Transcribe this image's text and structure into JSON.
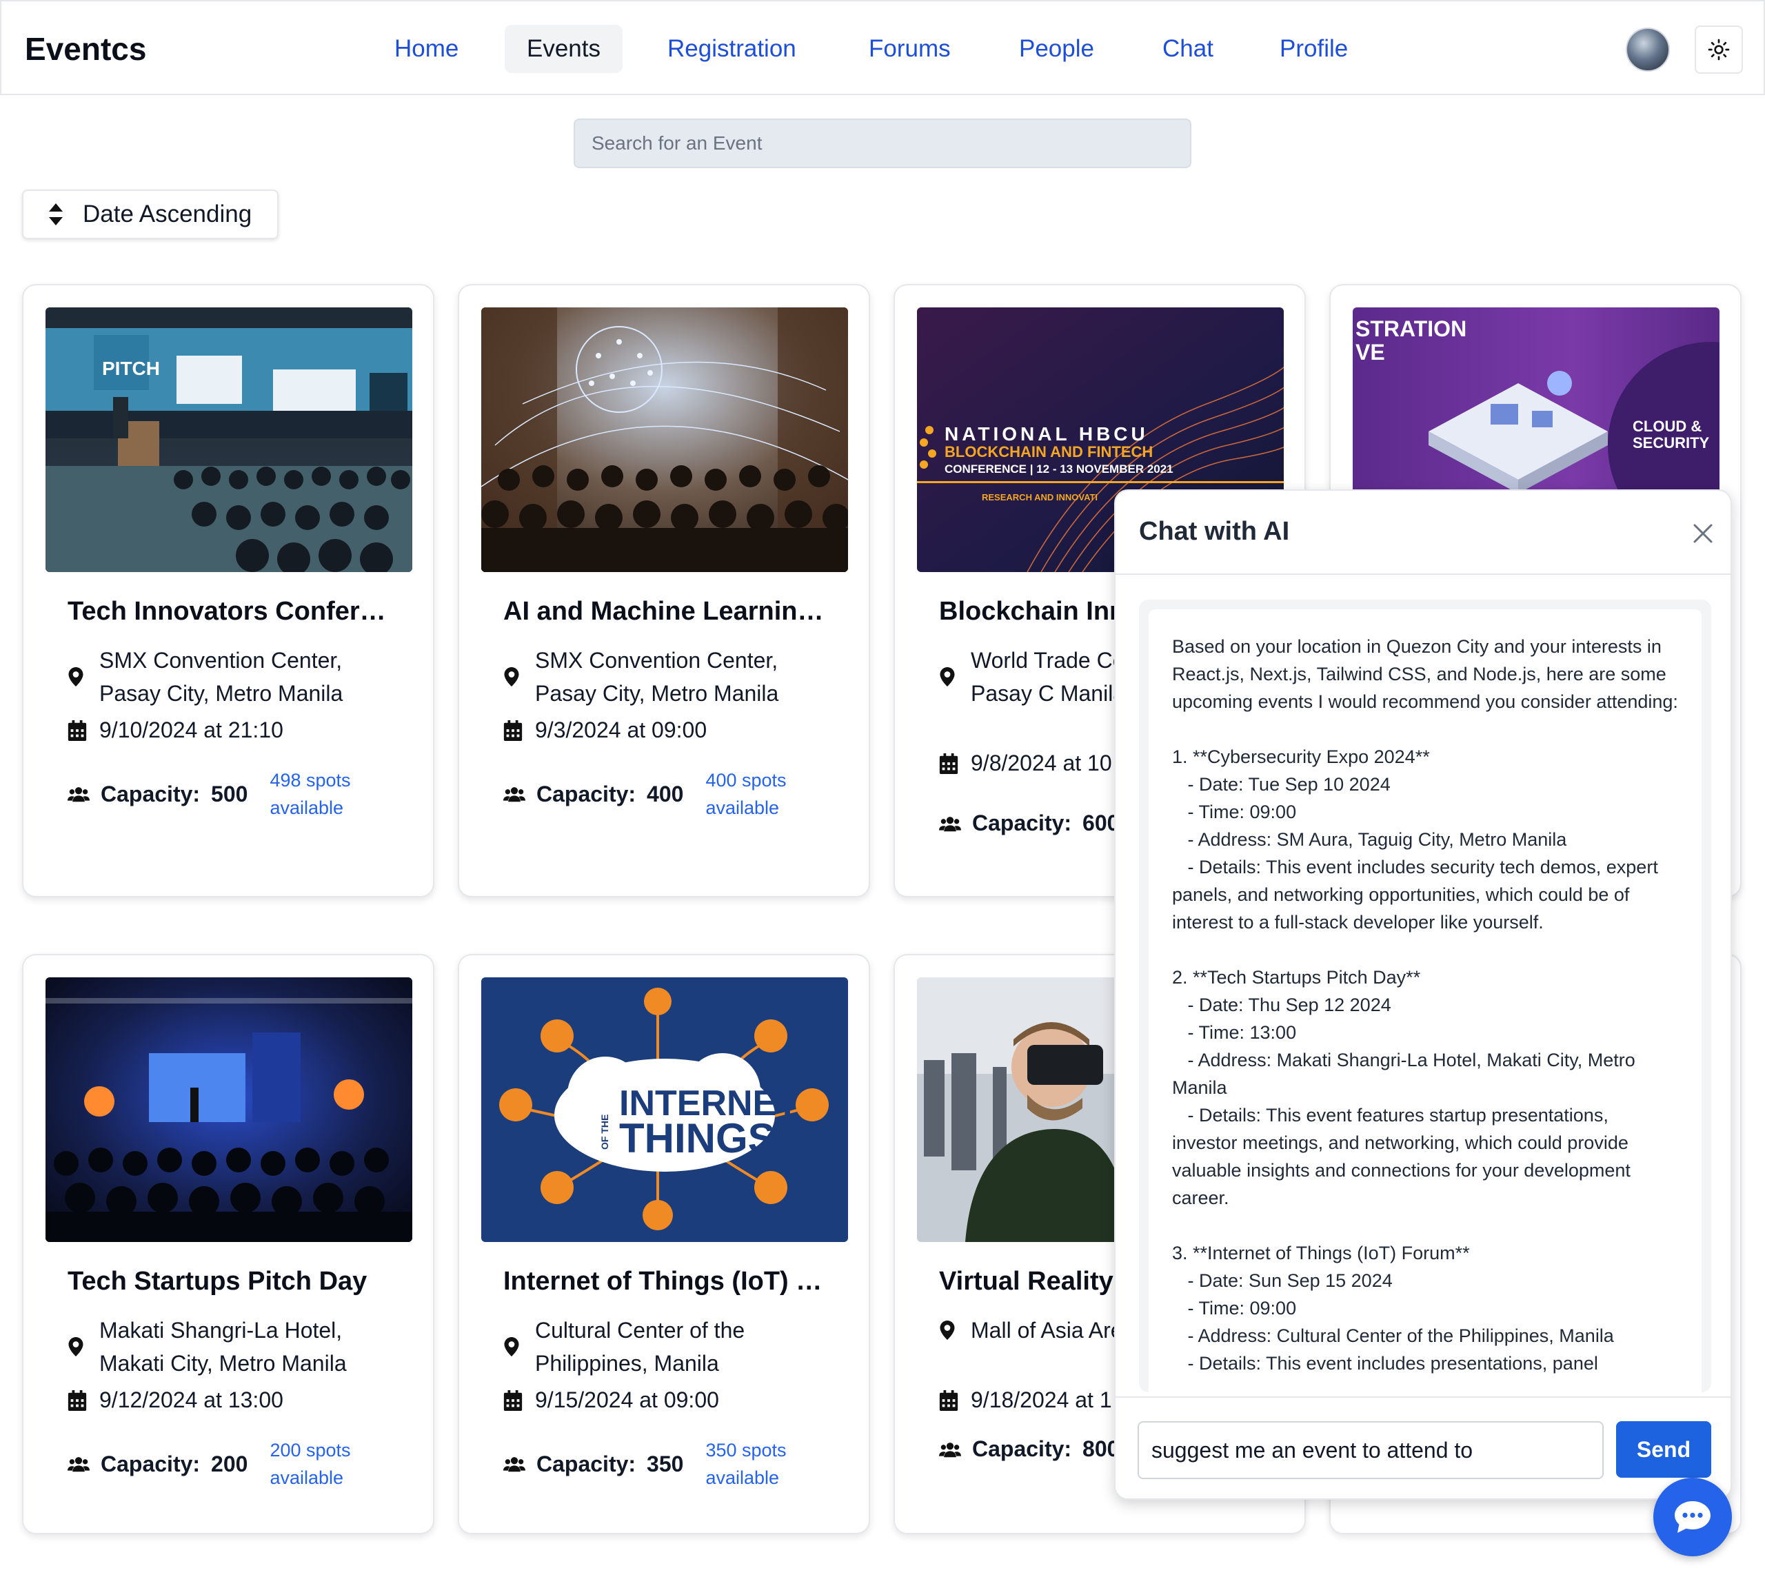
{
  "header": {
    "brand": "Eventcs",
    "nav": [
      {
        "label": "Home",
        "active": false
      },
      {
        "label": "Events",
        "active": true
      },
      {
        "label": "Registration",
        "active": false
      },
      {
        "label": "Forums",
        "active": false
      },
      {
        "label": "People",
        "active": false
      },
      {
        "label": "Chat",
        "active": false
      },
      {
        "label": "Profile",
        "active": false
      }
    ]
  },
  "search": {
    "placeholder": "Search for an Event"
  },
  "sort": {
    "label": "Date Ascending"
  },
  "capacity_label": "Capacity:",
  "events": [
    {
      "title": "Tech Innovators Confer…",
      "location": "SMX Convention Center, Pasay City, Metro Manila",
      "datetime": "9/10/2024 at 21:10",
      "capacity": "500",
      "spots": "498 spots available"
    },
    {
      "title": "AI and Machine Learnin…",
      "location": "SMX Convention Center, Pasay City, Metro Manila",
      "datetime": "9/3/2024 at 09:00",
      "capacity": "400",
      "spots": "400 spots available"
    },
    {
      "title": "Blockchain Inn",
      "location": "World Trade Cen Manila, Pasay C Manila",
      "datetime": "9/8/2024 at 10",
      "capacity": "600",
      "spots": ""
    },
    {
      "title": "",
      "location": "",
      "datetime": "",
      "capacity": "",
      "spots": ""
    },
    {
      "title": "Tech Startups Pitch Day",
      "location": "Makati Shangri-La Hotel, Makati City, Metro Manila",
      "datetime": "9/12/2024 at 13:00",
      "capacity": "200",
      "spots": "200 spots available"
    },
    {
      "title": "Internet of Things (IoT) …",
      "location": "Cultural Center of the Philippines, Manila",
      "datetime": "9/15/2024 at 09:00",
      "capacity": "350",
      "spots": "350 spots available"
    },
    {
      "title": "Virtual Reality",
      "location": "Mall of Asia Are Metro Manila",
      "datetime": "9/18/2024 at 1",
      "capacity": "800",
      "spots": ""
    },
    {
      "title": "",
      "location": "",
      "datetime": "",
      "capacity": "",
      "spots": ""
    }
  ],
  "image_text": {
    "pitch": "PITCH",
    "blockchain_1": "NATIONAL HBCU",
    "blockchain_2": "BLOCKCHAIN AND FINTECH",
    "blockchain_3": "CONFERENCE | 12 - 13 NOVEMBER 2021",
    "blockchain_4": "RESEARCH AND INNOVATI",
    "cloud_1": "STRATION",
    "cloud_2": "VE",
    "cloud_3": "CLOUD &",
    "cloud_4": "SECURITY",
    "iot_1": "INTERNET",
    "iot_2": "THINGS",
    "iot_3": "OF THE"
  },
  "chat": {
    "title": "Chat with AI",
    "message": "Based on your location in Quezon City and your interests in React.js, Next.js, Tailwind CSS, and Node.js, here are some upcoming events I would recommend you consider attending:\n\n1. **Cybersecurity Expo 2024**\n   - Date: Tue Sep 10 2024\n   - Time: 09:00\n   - Address: SM Aura, Taguig City, Metro Manila\n   - Details: This event includes security tech demos, expert panels, and networking opportunities, which could be of interest to a full-stack developer like yourself.\n\n2. **Tech Startups Pitch Day**\n   - Date: Thu Sep 12 2024\n   - Time: 13:00\n   - Address: Makati Shangri-La Hotel, Makati City, Metro Manila\n   - Details: This event features startup presentations, investor meetings, and networking, which could provide valuable insights and connections for your development career.\n\n3. **Internet of Things (IoT) Forum**\n   - Date: Sun Sep 15 2024\n   - Time: 09:00\n   - Address: Cultural Center of the Philippines, Manila\n   - Details: This event includes presentations, panel",
    "input_value": "suggest me an event to attend to",
    "send_label": "Send"
  },
  "colors": {
    "link": "#1d4ed8",
    "accent": "#2563eb",
    "send": "#1d63e0"
  }
}
